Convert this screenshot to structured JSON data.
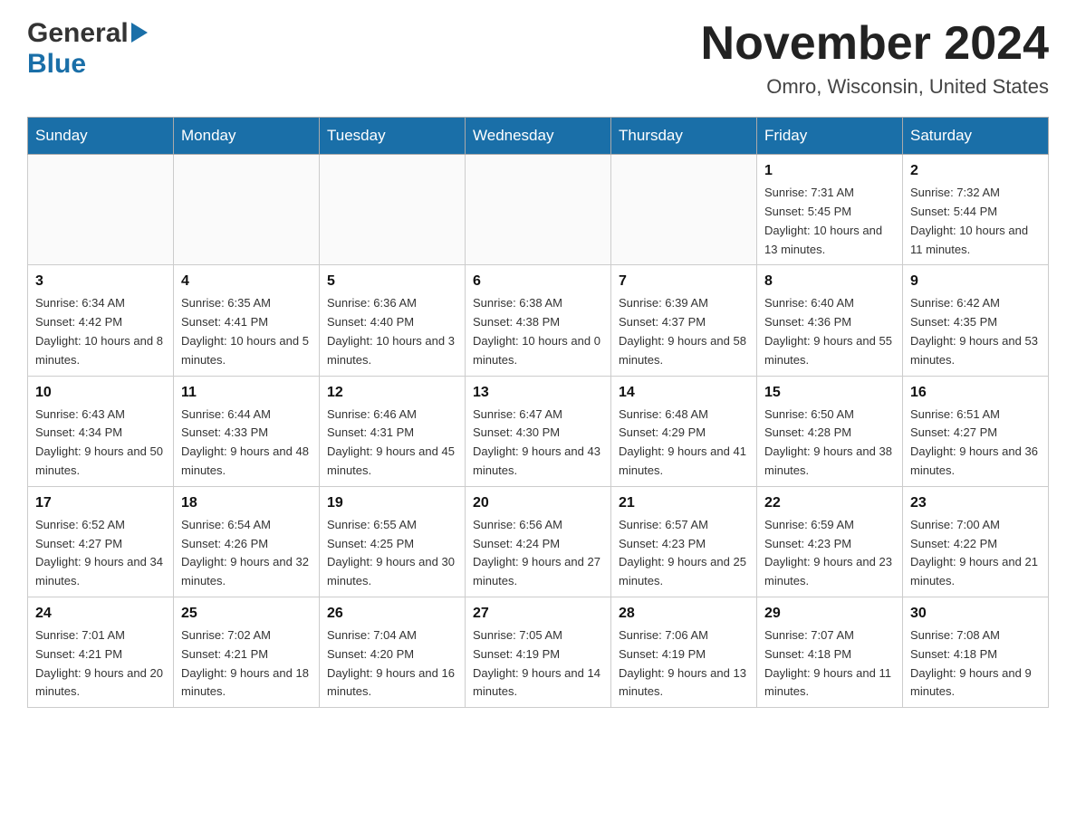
{
  "header": {
    "logo_general": "General",
    "logo_blue": "Blue",
    "title": "November 2024",
    "subtitle": "Omro, Wisconsin, United States"
  },
  "calendar": {
    "days_of_week": [
      "Sunday",
      "Monday",
      "Tuesday",
      "Wednesday",
      "Thursday",
      "Friday",
      "Saturday"
    ],
    "weeks": [
      [
        {
          "day": "",
          "info": ""
        },
        {
          "day": "",
          "info": ""
        },
        {
          "day": "",
          "info": ""
        },
        {
          "day": "",
          "info": ""
        },
        {
          "day": "",
          "info": ""
        },
        {
          "day": "1",
          "info": "Sunrise: 7:31 AM\nSunset: 5:45 PM\nDaylight: 10 hours and 13 minutes."
        },
        {
          "day": "2",
          "info": "Sunrise: 7:32 AM\nSunset: 5:44 PM\nDaylight: 10 hours and 11 minutes."
        }
      ],
      [
        {
          "day": "3",
          "info": "Sunrise: 6:34 AM\nSunset: 4:42 PM\nDaylight: 10 hours and 8 minutes."
        },
        {
          "day": "4",
          "info": "Sunrise: 6:35 AM\nSunset: 4:41 PM\nDaylight: 10 hours and 5 minutes."
        },
        {
          "day": "5",
          "info": "Sunrise: 6:36 AM\nSunset: 4:40 PM\nDaylight: 10 hours and 3 minutes."
        },
        {
          "day": "6",
          "info": "Sunrise: 6:38 AM\nSunset: 4:38 PM\nDaylight: 10 hours and 0 minutes."
        },
        {
          "day": "7",
          "info": "Sunrise: 6:39 AM\nSunset: 4:37 PM\nDaylight: 9 hours and 58 minutes."
        },
        {
          "day": "8",
          "info": "Sunrise: 6:40 AM\nSunset: 4:36 PM\nDaylight: 9 hours and 55 minutes."
        },
        {
          "day": "9",
          "info": "Sunrise: 6:42 AM\nSunset: 4:35 PM\nDaylight: 9 hours and 53 minutes."
        }
      ],
      [
        {
          "day": "10",
          "info": "Sunrise: 6:43 AM\nSunset: 4:34 PM\nDaylight: 9 hours and 50 minutes."
        },
        {
          "day": "11",
          "info": "Sunrise: 6:44 AM\nSunset: 4:33 PM\nDaylight: 9 hours and 48 minutes."
        },
        {
          "day": "12",
          "info": "Sunrise: 6:46 AM\nSunset: 4:31 PM\nDaylight: 9 hours and 45 minutes."
        },
        {
          "day": "13",
          "info": "Sunrise: 6:47 AM\nSunset: 4:30 PM\nDaylight: 9 hours and 43 minutes."
        },
        {
          "day": "14",
          "info": "Sunrise: 6:48 AM\nSunset: 4:29 PM\nDaylight: 9 hours and 41 minutes."
        },
        {
          "day": "15",
          "info": "Sunrise: 6:50 AM\nSunset: 4:28 PM\nDaylight: 9 hours and 38 minutes."
        },
        {
          "day": "16",
          "info": "Sunrise: 6:51 AM\nSunset: 4:27 PM\nDaylight: 9 hours and 36 minutes."
        }
      ],
      [
        {
          "day": "17",
          "info": "Sunrise: 6:52 AM\nSunset: 4:27 PM\nDaylight: 9 hours and 34 minutes."
        },
        {
          "day": "18",
          "info": "Sunrise: 6:54 AM\nSunset: 4:26 PM\nDaylight: 9 hours and 32 minutes."
        },
        {
          "day": "19",
          "info": "Sunrise: 6:55 AM\nSunset: 4:25 PM\nDaylight: 9 hours and 30 minutes."
        },
        {
          "day": "20",
          "info": "Sunrise: 6:56 AM\nSunset: 4:24 PM\nDaylight: 9 hours and 27 minutes."
        },
        {
          "day": "21",
          "info": "Sunrise: 6:57 AM\nSunset: 4:23 PM\nDaylight: 9 hours and 25 minutes."
        },
        {
          "day": "22",
          "info": "Sunrise: 6:59 AM\nSunset: 4:23 PM\nDaylight: 9 hours and 23 minutes."
        },
        {
          "day": "23",
          "info": "Sunrise: 7:00 AM\nSunset: 4:22 PM\nDaylight: 9 hours and 21 minutes."
        }
      ],
      [
        {
          "day": "24",
          "info": "Sunrise: 7:01 AM\nSunset: 4:21 PM\nDaylight: 9 hours and 20 minutes."
        },
        {
          "day": "25",
          "info": "Sunrise: 7:02 AM\nSunset: 4:21 PM\nDaylight: 9 hours and 18 minutes."
        },
        {
          "day": "26",
          "info": "Sunrise: 7:04 AM\nSunset: 4:20 PM\nDaylight: 9 hours and 16 minutes."
        },
        {
          "day": "27",
          "info": "Sunrise: 7:05 AM\nSunset: 4:19 PM\nDaylight: 9 hours and 14 minutes."
        },
        {
          "day": "28",
          "info": "Sunrise: 7:06 AM\nSunset: 4:19 PM\nDaylight: 9 hours and 13 minutes."
        },
        {
          "day": "29",
          "info": "Sunrise: 7:07 AM\nSunset: 4:18 PM\nDaylight: 9 hours and 11 minutes."
        },
        {
          "day": "30",
          "info": "Sunrise: 7:08 AM\nSunset: 4:18 PM\nDaylight: 9 hours and 9 minutes."
        }
      ]
    ]
  }
}
